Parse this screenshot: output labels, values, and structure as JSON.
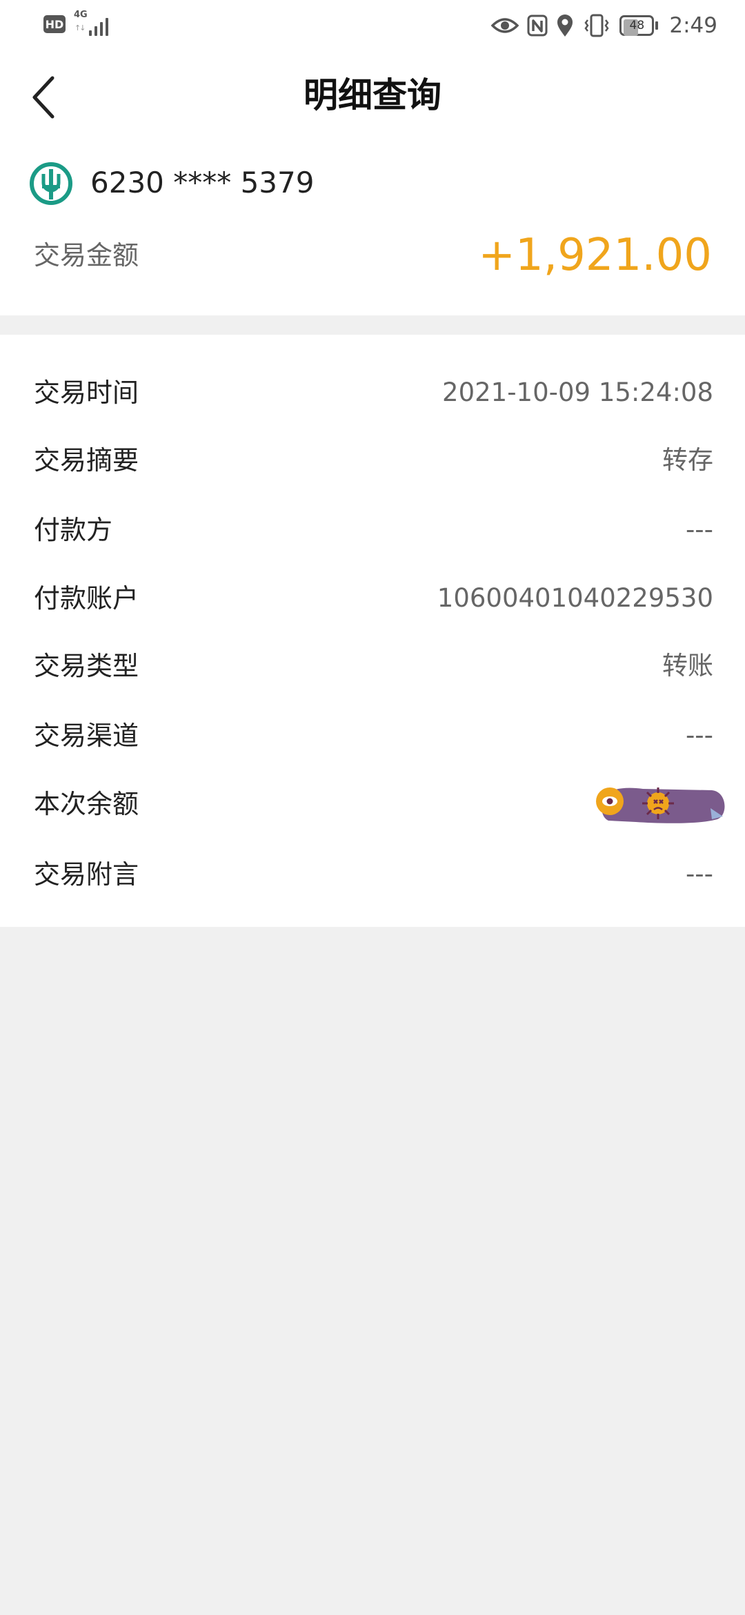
{
  "status_bar": {
    "hd_label": "HD",
    "network_label": "4G",
    "network_activity": "↑↓",
    "battery_level": "48",
    "time": "2:49",
    "icons": [
      "hd-icon",
      "signal-icon",
      "eye-icon",
      "nfc-icon",
      "location-icon",
      "vibrate-icon",
      "battery-icon"
    ]
  },
  "header": {
    "title": "明细查询",
    "back_icon": "chevron-left-icon"
  },
  "card": {
    "bank_icon": "bank-logo-icon",
    "number": "6230 **** 5379",
    "amount_label": "交易金额",
    "amount": "+1,921.00",
    "amount_color": "#f0a51c"
  },
  "details": [
    {
      "label": "交易时间",
      "value": "2021-10-09 15:24:08"
    },
    {
      "label": "交易摘要",
      "value": "转存"
    },
    {
      "label": "付款方",
      "value": "---"
    },
    {
      "label": "付款账户",
      "value": "10600401040229530"
    },
    {
      "label": "交易类型",
      "value": "转账"
    },
    {
      "label": "交易渠道",
      "value": "---"
    },
    {
      "label": "本次余额",
      "value": ""
    },
    {
      "label": "交易附言",
      "value": "---"
    }
  ],
  "colors": {
    "page_background": "#f0f0f0",
    "bank_green": "#1b9b86",
    "sticker_purple": "#7b5b8c"
  }
}
